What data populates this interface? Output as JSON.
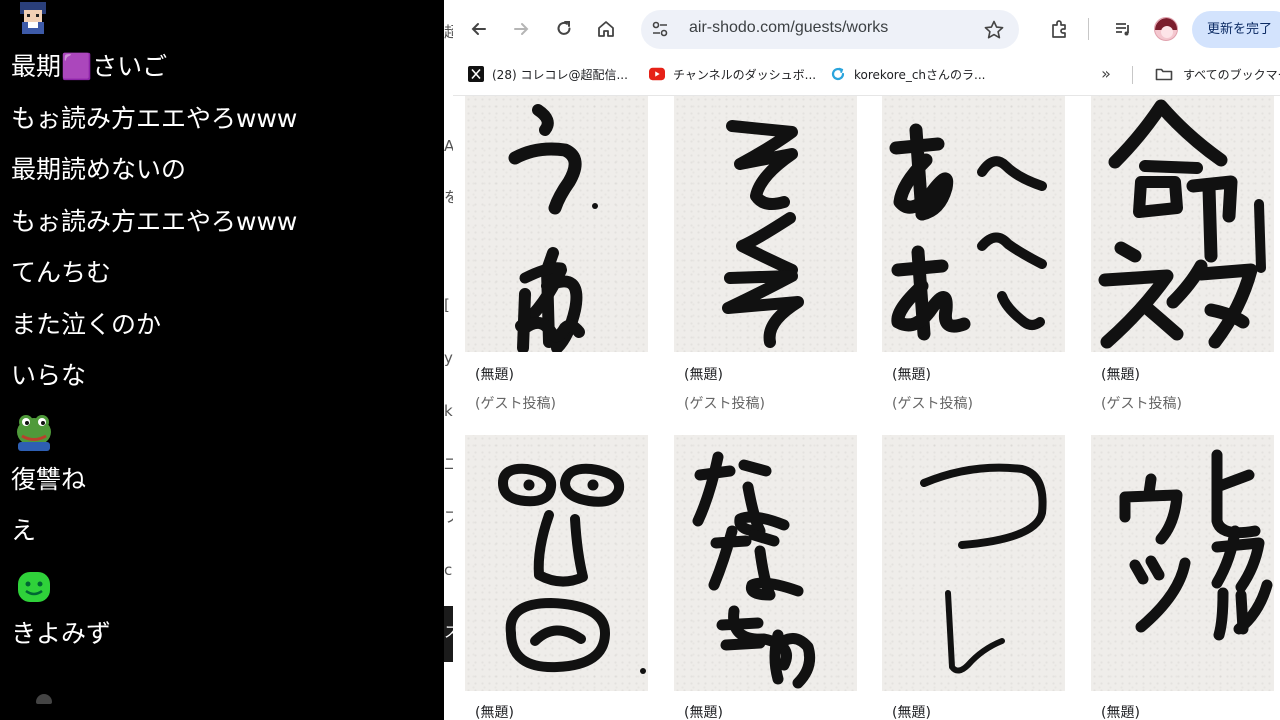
{
  "chat": {
    "messages": [
      {
        "type": "text",
        "text": "最期🟪さいご"
      },
      {
        "type": "text",
        "text": "もぉ読み方エエやろwww"
      },
      {
        "type": "text",
        "text": "最期読めないの"
      },
      {
        "type": "text",
        "text": "もぉ読み方エエやろwww"
      },
      {
        "type": "text",
        "text": "てんちむ"
      },
      {
        "type": "text",
        "text": "また泣くのか"
      },
      {
        "type": "text",
        "text": "いらな"
      },
      {
        "type": "emoji",
        "icon": "frog-emoji-icon"
      },
      {
        "type": "text",
        "text": "復讐ね"
      },
      {
        "type": "text",
        "text": "え"
      },
      {
        "type": "emoji",
        "icon": "green-smiley-icon"
      },
      {
        "type": "text",
        "text": "きよみず"
      }
    ]
  },
  "browser": {
    "url": "air-shodo.com/guests/works",
    "update_button": "更新を完了",
    "bookmarks": [
      {
        "icon": "x-logo-icon",
        "label": "(28) コレコレ@超配信..."
      },
      {
        "icon": "youtube-icon",
        "label": "チャンネルのダッシュボ..."
      },
      {
        "icon": "refresh-logo-icon",
        "label": "korekore_chさんのラ..."
      }
    ],
    "all_bookmarks": "すべてのブックマー",
    "left_strip_chars": [
      "超",
      "A",
      "を",
      "[",
      "y",
      "k",
      "二",
      "フ",
      "c",
      "ス"
    ]
  },
  "gallery": {
    "works": [
      {
        "title": "(無題)",
        "author": "(ゲスト投稿)",
        "calligraphy": "うおん"
      },
      {
        "title": "(無題)",
        "author": "(ゲスト投稿)",
        "calligraphy": "そくそ"
      },
      {
        "title": "(無題)",
        "author": "(ゲスト投稿)",
        "calligraphy": "ああへへ"
      },
      {
        "title": "(無題)",
        "author": "(ゲスト投稿)",
        "calligraphy": "命ネタ"
      },
      {
        "title": "(無題)",
        "author": "",
        "calligraphy": ""
      },
      {
        "title": "(無題)",
        "author": "",
        "calligraphy": "ななもり"
      },
      {
        "title": "(無題)",
        "author": "",
        "calligraphy": "つし"
      },
      {
        "title": "(無題)",
        "author": "",
        "calligraphy": "ヒカルウツ"
      }
    ]
  },
  "colors": {
    "chat_bg": "#000000",
    "chat_text": "#ffffff",
    "omnibox_bg": "#eef1f8",
    "update_button_bg": "#d3e3fd",
    "paper": "#efedea"
  }
}
